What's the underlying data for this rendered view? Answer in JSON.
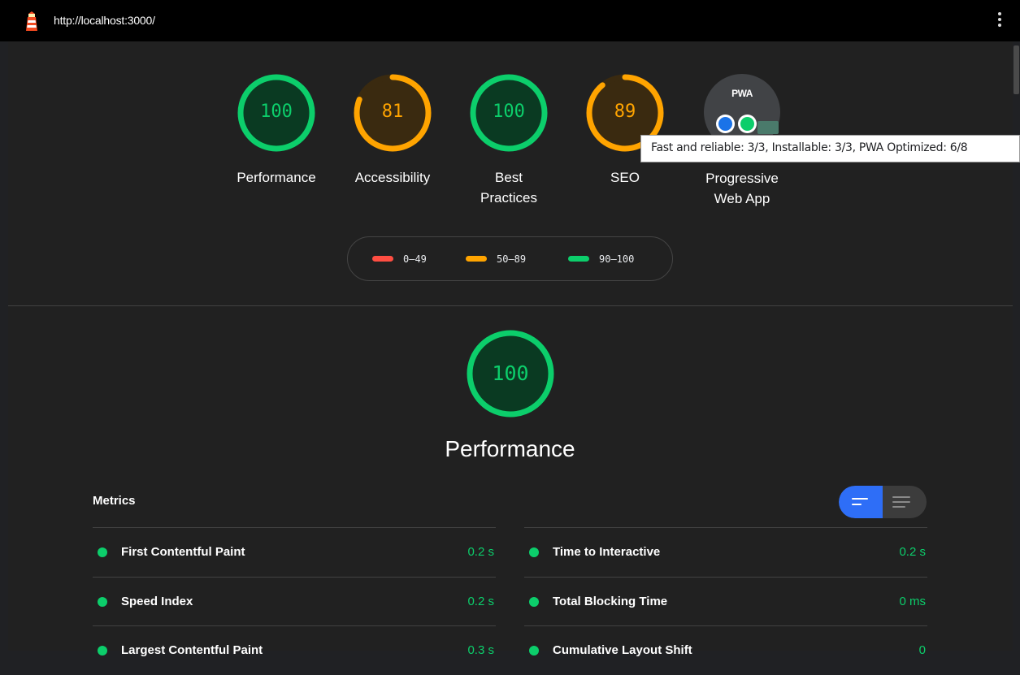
{
  "browser": {
    "url": "http://localhost:3000/"
  },
  "colors": {
    "pass": "#0cce6b",
    "average": "#ffa400",
    "fail": "#ff4e42",
    "background": "#212121"
  },
  "categories": [
    {
      "label": "Performance",
      "score": 100,
      "rating": "pass"
    },
    {
      "label": "Accessibility",
      "score": 81,
      "rating": "average"
    },
    {
      "label": "Best Practices",
      "score": 100,
      "rating": "pass"
    },
    {
      "label": "SEO",
      "score": 89,
      "rating": "average"
    }
  ],
  "pwa": {
    "badge": "PWA",
    "label": "Progressive Web App",
    "tooltip": "Fast and reliable: 3/3, Installable: 3/3, PWA Optimized: 6/8"
  },
  "legend": [
    {
      "range": "0–49",
      "rating": "fail"
    },
    {
      "range": "50–89",
      "rating": "average"
    },
    {
      "range": "90–100",
      "rating": "pass"
    }
  ],
  "performance": {
    "score": 100,
    "title": "Performance",
    "metrics_title": "Metrics",
    "metrics": [
      {
        "name": "First Contentful Paint",
        "value": "0.2 s"
      },
      {
        "name": "Time to Interactive",
        "value": "0.2 s"
      },
      {
        "name": "Speed Index",
        "value": "0.2 s"
      },
      {
        "name": "Total Blocking Time",
        "value": "0 ms"
      },
      {
        "name": "Largest Contentful Paint",
        "value": "0.3 s"
      },
      {
        "name": "Cumulative Layout Shift",
        "value": "0"
      }
    ]
  }
}
